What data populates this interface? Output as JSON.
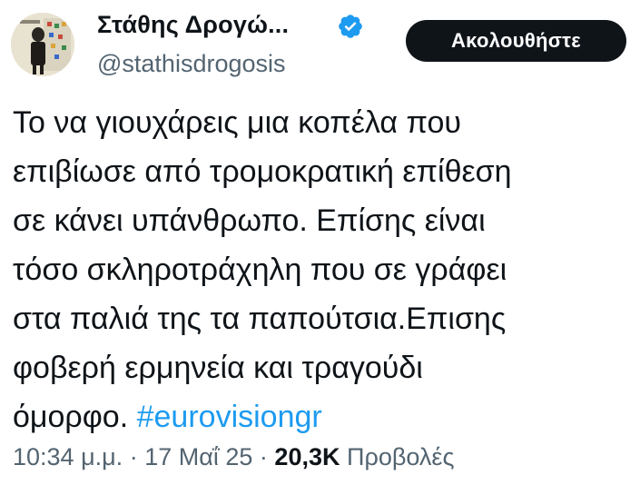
{
  "author": {
    "display_name": "Στάθης Δρογώ...",
    "handle": "@stathisdrogosis",
    "verified": true,
    "avatar_icon": "profile-photo"
  },
  "follow_button": {
    "label": "Ακολουθήστε"
  },
  "tweet": {
    "lines": [
      "Το να γιουχάρεις μια κοπέλα που",
      "επιβίωσε από τρομοκρατική επίθεση",
      "σε κάνει υπάνθρωπο. Επίσης είναι",
      "τόσο σκληροτράχηλη που σε γράφει",
      "στα παλιά της τα παπούτσια.Επισης",
      "φοβερή ερμηνεία και τραγούδι"
    ],
    "last_line_text": "όμορφο.",
    "hashtag": "#eurovisiongr"
  },
  "meta": {
    "time": "10:34 μ.μ.",
    "separator": "·",
    "date": "17 Μαΐ 25",
    "views_count": "20,3K",
    "views_label": "Προβολές"
  },
  "colors": {
    "text": "#0f1419",
    "secondary": "#536471",
    "link": "#1d9bf0",
    "verified": "#1d9bf0",
    "button_bg": "#0f1419"
  }
}
